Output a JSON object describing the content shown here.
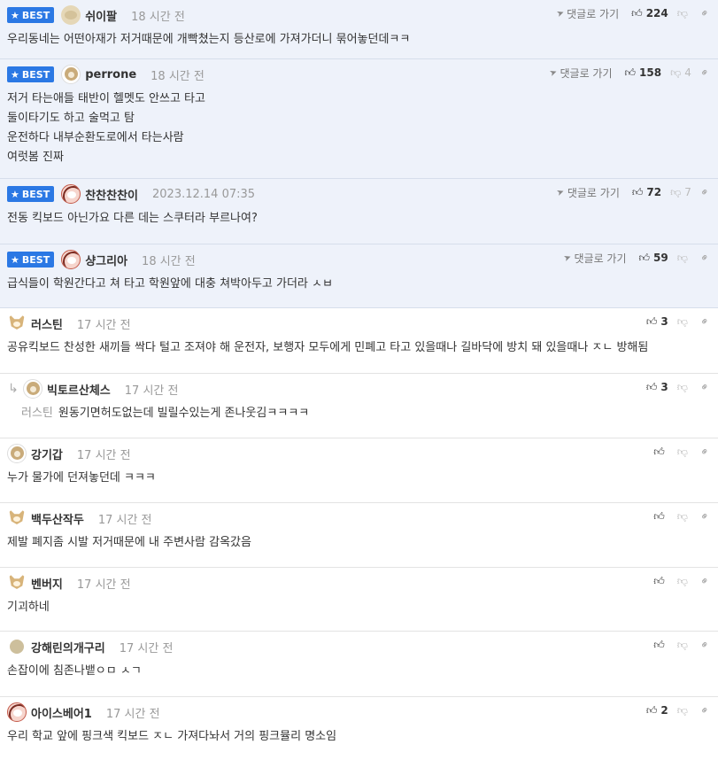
{
  "labels": {
    "best": "BEST",
    "goto_reply": "댓글로 가기"
  },
  "icons": {
    "star": "star-icon",
    "plane": "paper-plane-icon",
    "thumbs_up": "thumbs-up-icon",
    "thumbs_down": "thumbs-down-icon",
    "link": "link-icon",
    "reply_arrow": "reply-arrow-icon"
  },
  "colors": {
    "best_badge": "#2b78e4",
    "best_background": "#eef2fa"
  },
  "comments": [
    {
      "best": true,
      "reply": false,
      "avatar": "blob",
      "nick": "쉬이팔",
      "time": "18 시간 전",
      "likes": "224",
      "dislikes": "",
      "show_goto": true,
      "height": 67,
      "text": [
        "우리동네는 어떤아재가 저거때문에 개빡쳤는지 등산로에 가져가더니 묶어놓던데ㅋㅋ"
      ]
    },
    {
      "best": true,
      "reply": false,
      "avatar": "dog",
      "nick": "perrone",
      "time": "18 시간 전",
      "likes": "158",
      "dislikes": "4",
      "show_goto": true,
      "height": 135,
      "text": [
        "저거 타는애들 태반이 헬멧도 안쓰고 타고",
        "둘이타기도 하고 술먹고 탐",
        "운전하다 내부순환도로에서 타는사람",
        "여럿봄 진짜"
      ]
    },
    {
      "best": true,
      "reply": false,
      "avatar": "monkey",
      "nick": "찬찬찬찬이",
      "time": "2023.12.14 07:35",
      "likes": "72",
      "dislikes": "7",
      "show_goto": true,
      "height": 74,
      "text": [
        "전동 킥보드 아닌가요 다른 데는 스쿠터라 부르나여?"
      ]
    },
    {
      "best": true,
      "reply": false,
      "avatar": "monkey",
      "nick": "샹그리아",
      "time": "18 시간 전",
      "likes": "59",
      "dislikes": "",
      "show_goto": true,
      "height": 72,
      "text": [
        "급식들이 학원간다고 쳐 타고 학원앞에 대충 쳐박아두고 가더라 ㅅㅂ"
      ]
    },
    {
      "best": false,
      "reply": false,
      "avatar": "cat",
      "nick": "러스틴",
      "time": "17 시간 전",
      "likes": "3",
      "dislikes": "",
      "show_goto": false,
      "height": 74,
      "text": [
        "공유킥보드 찬성한 새끼들 싹다 털고 조져야 해 운전자, 보행자 모두에게 민폐고 타고 있을때나 길바닥에 방치 돼 있을때나 ㅈㄴ 방해됨"
      ]
    },
    {
      "best": false,
      "reply": true,
      "avatar": "dog",
      "nick": "빅토르산체스",
      "time": "17 시간 전",
      "likes": "3",
      "dislikes": "",
      "show_goto": false,
      "height": 73,
      "mention": "러스틴",
      "text": [
        "원동기면허도없는데 빌릴수있는게 존나웃김ㅋㅋㅋㅋ"
      ]
    },
    {
      "best": false,
      "reply": false,
      "avatar": "dog",
      "nick": "강기갑",
      "time": "17 시간 전",
      "likes": "",
      "dislikes": "",
      "show_goto": false,
      "height": 73,
      "text": [
        "누가 물가에 던져놓던데 ㅋㅋㅋ"
      ]
    },
    {
      "best": false,
      "reply": false,
      "avatar": "cat",
      "nick": "백두산작두",
      "time": "17 시간 전",
      "likes": "",
      "dislikes": "",
      "show_goto": false,
      "height": 73,
      "text": [
        "제발 폐지좀 시발 저거때문에 내 주변사람 감옥갔음"
      ]
    },
    {
      "best": false,
      "reply": false,
      "avatar": "cat",
      "nick": "벤버지",
      "time": "17 시간 전",
      "likes": "",
      "dislikes": "",
      "show_goto": false,
      "height": 72,
      "text": [
        "기괴하네"
      ]
    },
    {
      "best": false,
      "reply": false,
      "avatar": "dot",
      "nick": "강해린의개구리",
      "time": "17 시간 전",
      "likes": "",
      "dislikes": "",
      "show_goto": false,
      "height": 74,
      "text": [
        "손잡이에 침존나뱉ㅇㅁ ㅅㄱ"
      ]
    },
    {
      "best": false,
      "reply": false,
      "avatar": "monkey",
      "nick": "아이스베어1",
      "time": "17 시간 전",
      "likes": "2",
      "dislikes": "",
      "show_goto": false,
      "height": 72,
      "text": [
        "우리 학교 앞에 핑크색 킥보드 ㅈㄴ 가져다놔서 거의 핑크뮬리 명소임"
      ]
    }
  ]
}
